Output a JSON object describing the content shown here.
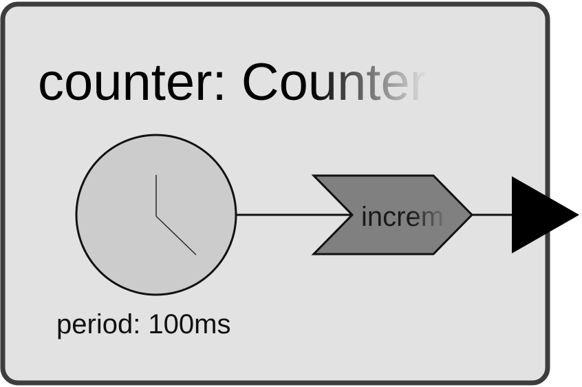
{
  "reactor": {
    "title": "counter: Counter",
    "fill_color": "#e2e2e2",
    "border_color": "#3d3d3d"
  },
  "timer": {
    "label": "period: 100ms",
    "fill_color": "#cccccc",
    "icon": "clock-icon"
  },
  "reaction": {
    "label": "increm",
    "fill_color": "#808080"
  },
  "output_port": {
    "icon": "triangle-port-icon",
    "color": "#000000"
  }
}
